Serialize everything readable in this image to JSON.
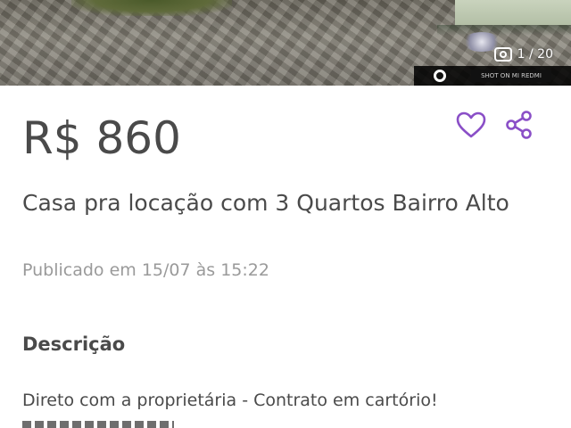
{
  "photo": {
    "counter": "1 / 20",
    "stamp": "SHOT ON MI REDMI"
  },
  "listing": {
    "price": "R$ 860",
    "title": "Casa pra locação com 3 Quartos Bairro Alto",
    "published": "Publicado em 15/07 às 15:22"
  },
  "description": {
    "heading": "Descrição",
    "text": "Direto com a proprietária - Contrato em cartório!"
  },
  "colors": {
    "accent": "#8a4fc7",
    "text": "#4a4a4a",
    "muted": "#9a9a9a"
  },
  "icons": {
    "favorite": "heart-outline",
    "share": "share-nodes"
  }
}
